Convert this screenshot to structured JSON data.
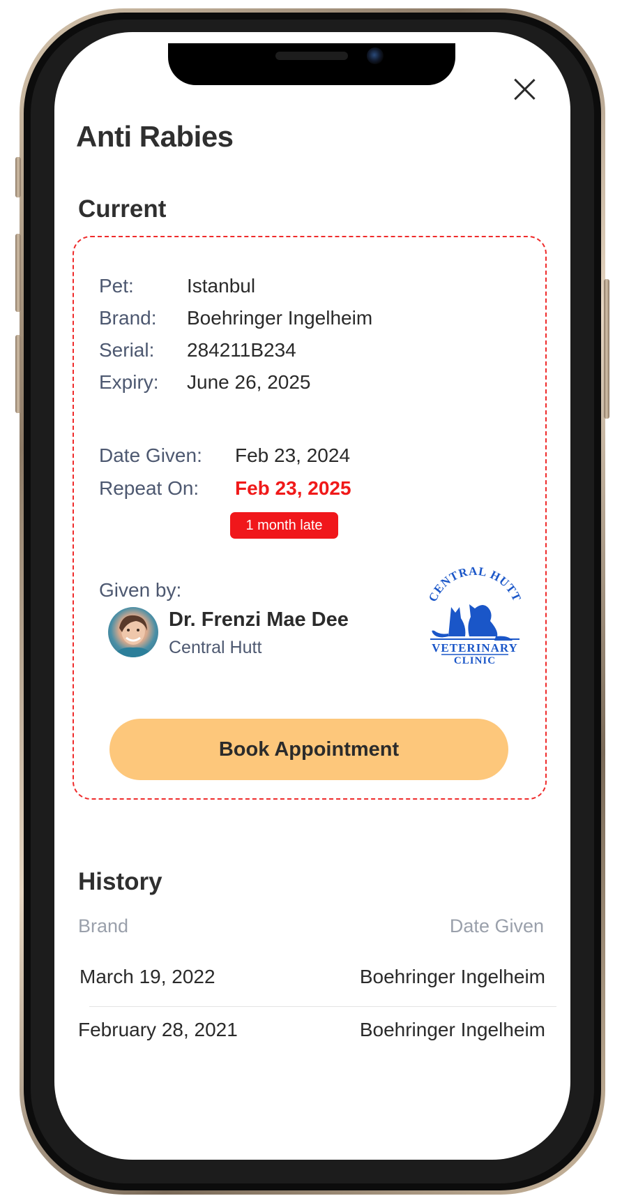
{
  "vaccine_title": "Anti Rabies",
  "current": {
    "heading": "Current",
    "pet_label": "Pet:",
    "pet_value": "Istanbul",
    "brand_label": "Brand:",
    "brand_value": "Boehringer Ingelheim",
    "serial_label": "Serial:",
    "serial_value": "284211B234",
    "expiry_label": "Expiry:",
    "expiry_value": "June 26, 2025",
    "date_given_label": "Date Given:",
    "date_given_value": "Feb 23, 2024",
    "repeat_on_label": "Repeat On:",
    "repeat_on_value": "Feb 23, 2025",
    "late_badge": "1 month late",
    "given_by_label": "Given by:",
    "vet_name": "Dr. Frenzi Mae Dee",
    "vet_clinic": "Central Hutt",
    "clinic_logo_text": [
      "CENTRAL HUTT",
      "VETERINARY",
      "CLINIC"
    ],
    "book_button": "Book Appointment"
  },
  "history": {
    "heading": "History",
    "columns": [
      "Brand",
      "Date Given"
    ],
    "rows": [
      {
        "date": "March 19, 2022",
        "brand": "Boehringer Ingelheim"
      },
      {
        "date": "February 28, 2021",
        "brand": "Boehringer Ingelheim"
      }
    ]
  },
  "colors": {
    "late_red": "#f01919",
    "button_orange": "#fdc77b",
    "label_slate": "#4d5870",
    "logo_blue": "#1a56c8"
  },
  "icons": [
    "close-icon",
    "clinic-logo"
  ]
}
